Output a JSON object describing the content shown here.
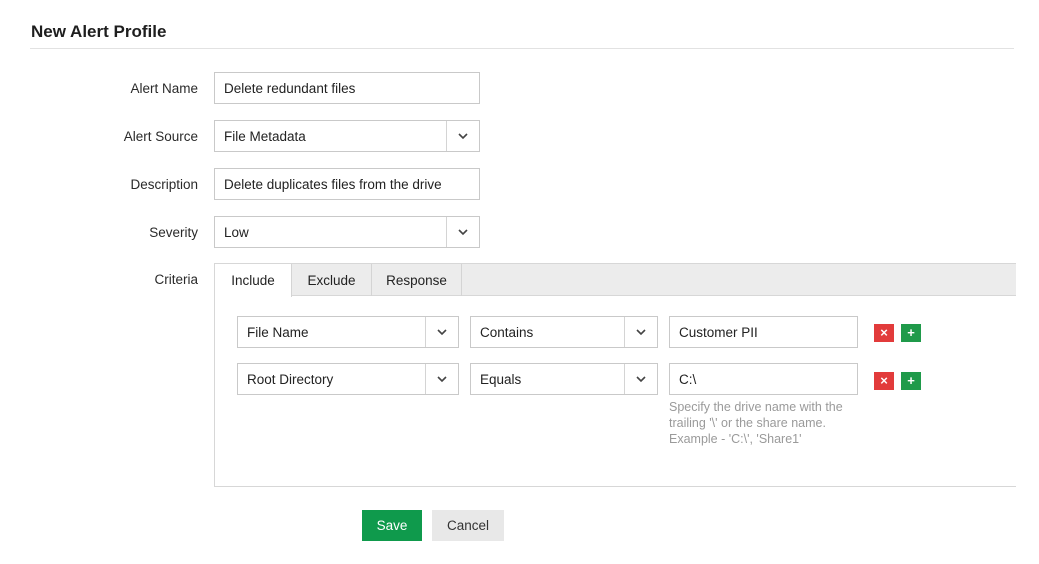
{
  "page": {
    "title": "New Alert Profile"
  },
  "form": {
    "alert_name": {
      "label": "Alert Name",
      "value": "Delete redundant files"
    },
    "alert_source": {
      "label": "Alert Source",
      "value": "File Metadata"
    },
    "description": {
      "label": "Description",
      "value": "Delete duplicates files from the drive"
    },
    "severity": {
      "label": "Severity",
      "value": "Low"
    },
    "criteria": {
      "label": "Criteria",
      "tabs": [
        {
          "label": "Include",
          "active": true
        },
        {
          "label": "Exclude",
          "active": false
        },
        {
          "label": "Response",
          "active": false
        }
      ],
      "rows": [
        {
          "field": "File Name",
          "operator": "Contains",
          "value": "Customer PII"
        },
        {
          "field": "Root Directory",
          "operator": "Equals",
          "value": "C:\\"
        }
      ],
      "hint": "Specify the drive name with the trailing '\\' or the share name. Example - 'C:\\', 'Share1'",
      "remove_symbol": "×",
      "add_symbol": "+"
    }
  },
  "actions": {
    "save_label": "Save",
    "cancel_label": "Cancel"
  },
  "colors": {
    "save": "#0f9a4c",
    "remove": "#e23b3b",
    "add": "#1f9a4a",
    "tab_strip": "#ececec"
  }
}
